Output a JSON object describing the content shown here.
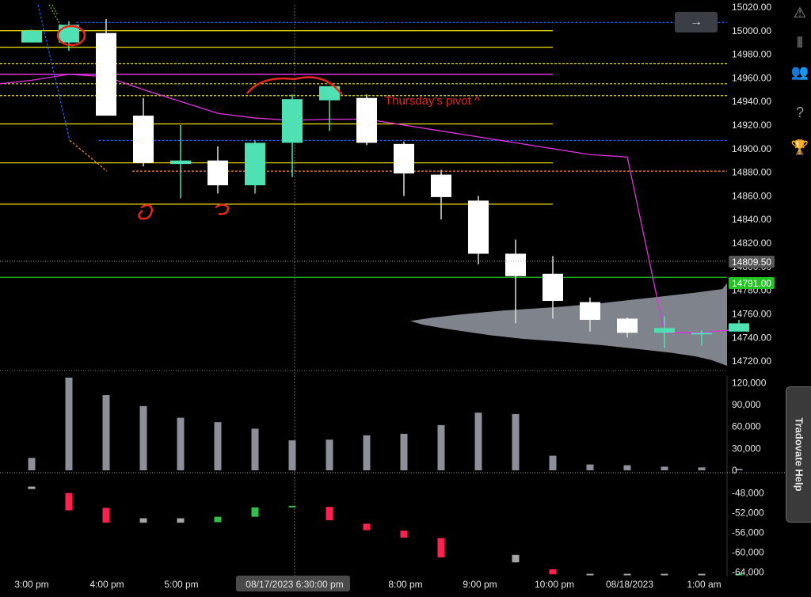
{
  "app": {
    "arrow_label": "→",
    "help_label": "Tradovate Help"
  },
  "side_icons": [
    {
      "name": "warning-icon",
      "glyph": "⚠"
    },
    {
      "name": "bars-icon",
      "glyph": "⦀"
    },
    {
      "name": "users-icon",
      "glyph": "👥"
    },
    {
      "name": "help-icon",
      "glyph": "?"
    },
    {
      "name": "trophy-icon",
      "glyph": "🏆"
    }
  ],
  "colors": {
    "bull": "#4fe0b4",
    "bear": "#ffffff",
    "wick_bull": "#4fe0b4",
    "wick_bear": "#dddddd",
    "yellow": "#f2e600",
    "magenta": "#e033e0",
    "blue": "#1e64ff",
    "orange": "#ff8a2a",
    "green_line": "#22c322",
    "delta_pos": "#2fbf4a",
    "delta_neg": "#ff2050",
    "delta_neutral": "#a6a6a6",
    "volume": "#8d9099",
    "annotation": "#e8281e",
    "crosshair_label_bg": "#4a4a4a"
  },
  "chart_data": {
    "type": "candlestick",
    "x_ticks": [
      "3:00 pm",
      "4:00 pm",
      "5:00 pm",
      "08/17/2023 6:30:00 pm",
      "8:00 pm",
      "9:00 pm",
      "10:00 pm",
      "08/18/2023",
      "1:00 am"
    ],
    "crosshair_label": "08/17/2023 6:30:00 pm",
    "price_axis": {
      "ylim": [
        14712,
        15026
      ],
      "ticks": [
        15020,
        15000,
        14980,
        14960,
        14940,
        14920,
        14900,
        14880,
        14860,
        14840,
        14820,
        14800,
        14780,
        14760,
        14740,
        14720
      ]
    },
    "current_price_label": "14809.50",
    "green_level_label": "14791.00",
    "candles": [
      {
        "t": 0,
        "o": 14990,
        "h": 15001,
        "l": 14990,
        "c": 15000
      },
      {
        "t": 1,
        "o": 14990,
        "h": 15008,
        "l": 14983,
        "c": 15005
      },
      {
        "t": 2,
        "o": 14998,
        "h": 15010,
        "l": 14980,
        "c": 14928
      },
      {
        "t": 3,
        "o": 14928,
        "h": 14943,
        "l": 14885,
        "c": 14888
      },
      {
        "t": 4,
        "o": 14887,
        "h": 14920,
        "l": 14858,
        "c": 14890
      },
      {
        "t": 5,
        "o": 14890,
        "h": 14902,
        "l": 14862,
        "c": 14869
      },
      {
        "t": 6,
        "o": 14869,
        "h": 14907,
        "l": 14862,
        "c": 14905
      },
      {
        "t": 7,
        "o": 14905,
        "h": 14946,
        "l": 14876,
        "c": 14942
      },
      {
        "t": 8,
        "o": 14941,
        "h": 14953,
        "l": 14915,
        "c": 14953
      },
      {
        "t": 9,
        "o": 14943,
        "h": 14946,
        "l": 14903,
        "c": 14905
      },
      {
        "t": 10,
        "o": 14904,
        "h": 14906,
        "l": 14860,
        "c": 14879
      },
      {
        "t": 11,
        "o": 14878,
        "h": 14882,
        "l": 14840,
        "c": 14859
      },
      {
        "t": 12,
        "o": 14856,
        "h": 14860,
        "l": 14802,
        "c": 14811
      },
      {
        "t": 13,
        "o": 14811,
        "h": 14823,
        "l": 14752,
        "c": 14792
      },
      {
        "t": 14,
        "o": 14794,
        "h": 14809,
        "l": 14756,
        "c": 14771
      },
      {
        "t": 15,
        "o": 14770,
        "h": 14774,
        "l": 14745,
        "c": 14755
      },
      {
        "t": 16,
        "o": 14756,
        "h": 14757,
        "l": 14740,
        "c": 14744
      },
      {
        "t": 17,
        "o": 14744,
        "h": 14758,
        "l": 14731,
        "c": 14748
      },
      {
        "t": 18,
        "o": 14744,
        "h": 14746,
        "l": 14733,
        "c": 14744
      },
      {
        "t": 19,
        "o": 14745,
        "h": 14755,
        "l": 14745,
        "c": 14752
      }
    ],
    "vwap": [
      14958,
      14963,
      14961,
      14950,
      14940,
      14930,
      14926,
      14924,
      14925,
      14925,
      14920,
      14915,
      14910,
      14905,
      14900,
      14895,
      14893,
      14744,
      14744,
      14747
    ],
    "levels": [
      {
        "price": 15007,
        "color": "blue",
        "dash": true,
        "x_start": 1.2,
        "x_end": 21
      },
      {
        "price": 15000,
        "color": "yellow",
        "dash": false,
        "x_start": 0,
        "x_end": 14
      },
      {
        "price": 14986,
        "color": "yellow",
        "dash": false,
        "x_start": 0,
        "x_end": 14
      },
      {
        "price": 14972,
        "color": "yellow",
        "dash": true,
        "x_start": 0,
        "x_end": 20
      },
      {
        "price": 14963,
        "color": "magenta",
        "dash": false,
        "x_start": 0,
        "x_end": 14
      },
      {
        "price": 14958,
        "color": "green",
        "dash": true,
        "x_start": 0,
        "x_end": 20
      },
      {
        "price": 14955,
        "color": "yellow",
        "dash": true,
        "x_start": 0,
        "x_end": 20
      },
      {
        "price": 14945,
        "color": "yellow",
        "dash": true,
        "x_start": 0,
        "x_end": 20
      },
      {
        "price": 14921,
        "color": "yellow",
        "dash": false,
        "x_start": 0,
        "x_end": 14
      },
      {
        "price": 14907,
        "color": "blue",
        "dash": true,
        "x_start": 1.8,
        "x_end": 21
      },
      {
        "price": 14888,
        "color": "yellow",
        "dash": false,
        "x_start": 0,
        "x_end": 14
      },
      {
        "price": 14881,
        "color": "orange",
        "dash": true,
        "x_start": 2.7,
        "x_end": 21
      },
      {
        "price": 14853,
        "color": "yellow",
        "dash": false,
        "x_start": 0,
        "x_end": 14
      },
      {
        "price": 14791,
        "color": "green_line",
        "dash": false,
        "x_start": 0,
        "x_end": 21
      }
    ],
    "annotation_text": "Thursday's pivot ^",
    "volume_axis": {
      "ylim": [
        0,
        128000
      ],
      "ticks": [
        "120,000",
        "90,000",
        "60,000",
        "30,000",
        "0"
      ],
      "tick_values": [
        120000,
        90000,
        60000,
        30000,
        0
      ]
    },
    "volume": [
      17000,
      127000,
      103000,
      88000,
      72000,
      66000,
      57000,
      41000,
      42000,
      48000,
      50000,
      62000,
      79000,
      77000,
      20000,
      8000,
      7000,
      5000,
      4000,
      2000
    ],
    "delta_axis": {
      "ylim": [
        -65000,
        -45500
      ],
      "ticks": [
        "-48,000",
        "-52,000",
        "-56,000",
        "-60,000",
        "-64,000"
      ],
      "tick_values": [
        -48000,
        -52000,
        -56000,
        -60000,
        -64000
      ]
    },
    "delta_top": -46500,
    "delta": [
      {
        "o": -46700,
        "c": -47200,
        "s": "neutral"
      },
      {
        "o": -48000,
        "c": -51500,
        "s": "neg"
      },
      {
        "o": -51000,
        "c": -54000,
        "s": "neg"
      },
      {
        "o": -53100,
        "c": -54000,
        "s": "neutral"
      },
      {
        "o": -53100,
        "c": -54000,
        "s": "neutral"
      },
      {
        "o": -53900,
        "c": -52800,
        "s": "pos"
      },
      {
        "o": -52800,
        "c": -50900,
        "s": "pos"
      },
      {
        "o": -50900,
        "c": -50600,
        "s": "pos"
      },
      {
        "o": -50800,
        "c": -53500,
        "s": "neg"
      },
      {
        "o": -54200,
        "c": -55500,
        "s": "neg"
      },
      {
        "o": -55600,
        "c": -57000,
        "s": "neg"
      },
      {
        "o": -57100,
        "c": -61000,
        "s": "neg"
      },
      {
        "o": null,
        "c": null,
        "s": "none"
      },
      {
        "o": -60500,
        "c": -62000,
        "s": "neutral"
      },
      {
        "o": -63400,
        "c": -64400,
        "s": "neg"
      },
      {
        "o": -64300,
        "c": -64450,
        "s": "neutral"
      },
      {
        "o": -64300,
        "c": -64450,
        "s": "neutral"
      },
      {
        "o": -64300,
        "c": -64450,
        "s": "neutral"
      },
      {
        "o": -64300,
        "c": -64450,
        "s": "neutral"
      },
      {
        "o": -64300,
        "c": -64600,
        "s": "pos"
      }
    ]
  }
}
